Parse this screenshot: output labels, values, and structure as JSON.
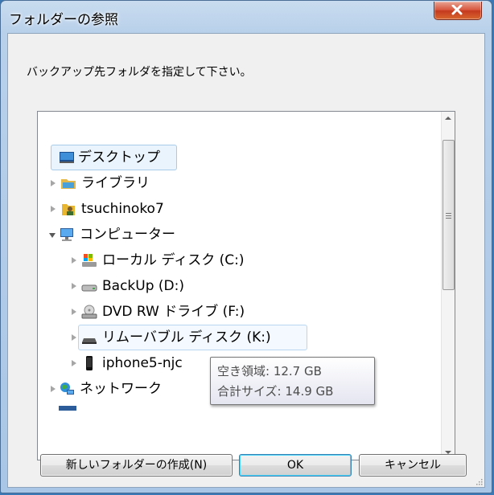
{
  "window": {
    "title": "フォルダーの参照"
  },
  "dialog": {
    "instruction": "バックアップ先フォルダを指定して下さい。",
    "tree_items": [
      {
        "label": "デスクトップ",
        "icon": "desktop-icon"
      },
      {
        "label": "ライブラリ",
        "icon": "library-icon"
      },
      {
        "label": "tsuchinoko7",
        "icon": "user-folder-icon"
      },
      {
        "label": "コンピューター",
        "icon": "computer-icon"
      },
      {
        "label": "ローカル ディスク (C:)",
        "icon": "system-drive-icon"
      },
      {
        "label": "BackUp (D:)",
        "icon": "hard-drive-icon"
      },
      {
        "label": "DVD RW ドライブ (F:)",
        "icon": "dvd-drive-icon"
      },
      {
        "label": "リムーバブル ディスク (K:)",
        "icon": "removable-disk-icon"
      },
      {
        "label": "iphone5-njc",
        "icon": "phone-icon"
      },
      {
        "label": "ネットワーク",
        "icon": "network-icon"
      }
    ],
    "tooltip": {
      "free_space": "空き領域: 12.7 GB",
      "total_size": "合計サイズ: 14.9 GB"
    },
    "buttons": {
      "new_folder": "新しいフォルダーの作成(N)",
      "ok": "OK",
      "cancel": "キャンセル"
    }
  },
  "colors": {
    "selection_bg": "#eaf4fc",
    "selection_border": "#a8cbe9",
    "close_button": "#c4391f"
  }
}
